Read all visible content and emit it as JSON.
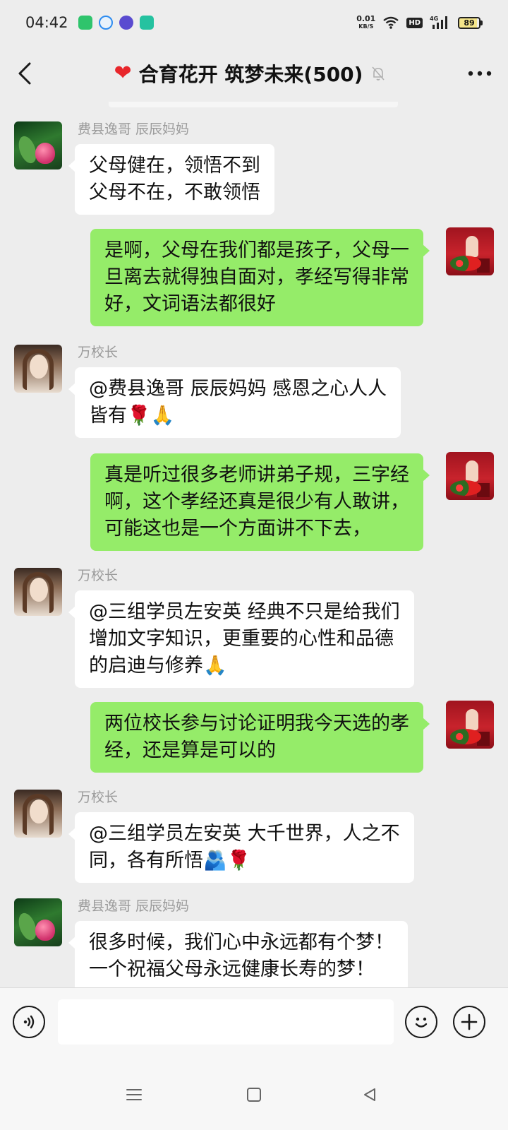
{
  "status_bar": {
    "time": "04:42",
    "net_speed_value": "0.01",
    "net_speed_unit": "KB/S",
    "hd_label": "HD",
    "network_type": "4G",
    "battery": "89"
  },
  "header": {
    "title": "合育花开 筑梦未来(500)",
    "heart_glyph": "❤"
  },
  "messages": [
    {
      "side": "in",
      "sender": "费县逸哥  辰辰妈妈",
      "lines": [
        "父母健在，领悟不到",
        "父母不在，不敢领悟"
      ],
      "avatar": "lotus-avatar"
    },
    {
      "side": "out",
      "lines": [
        "是啊，父母在我们都是孩子，父母一",
        "旦离去就得独自面对，孝经写得非常",
        "好，文词语法都很好"
      ],
      "avatar": "stage-avatar"
    },
    {
      "side": "in",
      "sender": "万校长",
      "lines": [
        "@费县逸哥  辰辰妈妈  感恩之心人人",
        "皆有🌹🙏"
      ],
      "avatar": "girl-avatar"
    },
    {
      "side": "out",
      "lines": [
        "真是听过很多老师讲弟子规，三字经",
        "啊，这个孝经还真是很少有人敢讲，",
        "可能这也是一个方面讲不下去，"
      ],
      "avatar": "stage-avatar"
    },
    {
      "side": "in",
      "sender": "万校长",
      "lines": [
        "@三组学员左安英  经典不只是给我们",
        "增加文字知识，更重要的心性和品德",
        "的启迪与修养🙏"
      ],
      "avatar": "girl-avatar"
    },
    {
      "side": "out",
      "lines": [
        "两位校长参与讨论证明我今天选的孝",
        "经，还是算是可以的"
      ],
      "avatar": "stage-avatar"
    },
    {
      "side": "in",
      "sender": "万校长",
      "lines": [
        "@三组学员左安英  大千世界，人之不",
        "同，各有所悟🫂🌹"
      ],
      "avatar": "girl-avatar"
    },
    {
      "side": "in",
      "sender": "费县逸哥  辰辰妈妈",
      "lines": [
        "很多时候，我们心中永远都有个梦！",
        "一个祝福父母永远健康长寿的梦！"
      ],
      "avatar": "lotus-avatar"
    }
  ],
  "input_bar": {
    "value": ""
  },
  "colors": {
    "background": "#ededed",
    "outgoing_bubble": "#95ec69",
    "incoming_bubble": "#ffffff",
    "sender_name": "#9b9b9b"
  }
}
